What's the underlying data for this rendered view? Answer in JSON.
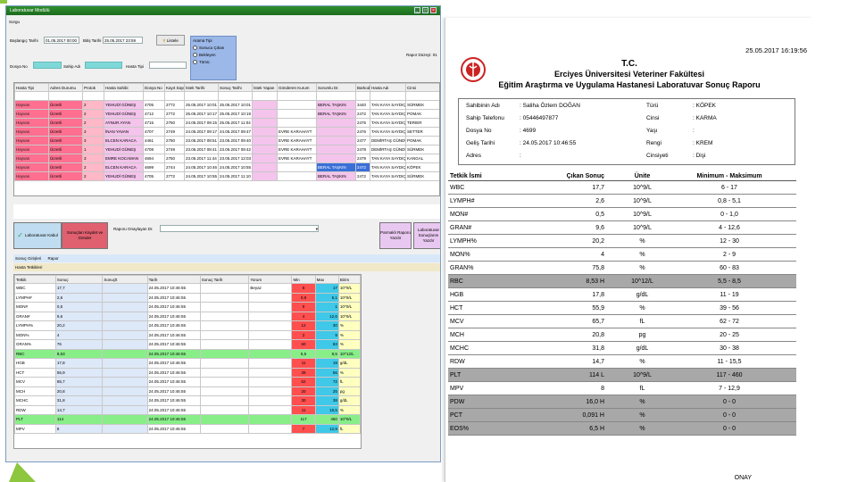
{
  "window": {
    "title": "Laboratuvar Modülü"
  },
  "form": {
    "section": "Sorgu",
    "baslangic_label": "Başlangıç Tarihi",
    "baslangic_value": "01.05.2017 00:00",
    "bitis_label": "Bitiş Tarihi",
    "bitis_value": "25.05.2017 23:59",
    "listele": "Listele",
    "dosya_label": "Dosya No",
    "sahip_label": "Sahip Adı",
    "hasta_label": "Hasta Tipi",
    "filter_title": "Arama Tipi",
    "filter_opts": [
      "Sonucu Çıkan",
      "Bekleyen",
      "Tümü"
    ],
    "rapor_label": "Rapor Düzeyi: 01"
  },
  "grid1": {
    "headers": [
      "Hasta Tipi",
      "Adres Durumu",
      "Protok",
      "Hasta Sahibi",
      "Dosya No",
      "Kayıt Sayısı",
      "İstek Tarihi",
      "Sonuç Tarihi",
      "İstek Yapan",
      "Gönderen Kurum",
      "Sorumlu Dr.",
      "Barkod",
      "Hasta Adı",
      "Cinsi"
    ],
    "rows": [
      [
        "Hayvan",
        "Ücretli",
        "2",
        "YEHUDİ GÜNEŞ",
        "4705",
        "2772",
        "25.05.2017 10:01",
        "25.05.2017 10:01",
        "",
        "",
        "BERAL TAŞKIN",
        "3440",
        "TAN KAYA SAYDIÇ",
        "SÜRMEK"
      ],
      [
        "Hayvan",
        "Ücretli",
        "2",
        "YEHUDİ GÜNEŞ",
        "4712",
        "2772",
        "25.05.2017 10:17",
        "25.05.2017 10:19",
        "",
        "",
        "BERAL TAŞKIN",
        "2472",
        "TAN KAYA SAYDIÇ",
        "POMAK"
      ],
      [
        "Hayvan",
        "Ücretli",
        "2",
        "AYNUR AYAN",
        "4715",
        "2750",
        "24.05.2017 09:15",
        "25.05.2017 11:04",
        "",
        "",
        "",
        "2475",
        "TAN KAYA SAYDIÇ",
        "TERIER"
      ],
      [
        "Hayvan",
        "Ücretli",
        "3",
        "İNAN YAVAN",
        "4707",
        "2749",
        "24.05.2017 09:17",
        "24.05.2017 09:47",
        "",
        "EVRE KARAHAYT",
        "",
        "2476",
        "TAN KAYA SAYDIÇ",
        "SETTER"
      ],
      [
        "Hayvan",
        "Ücretli",
        "3",
        "ELCEN KARACA",
        "4461",
        "2750",
        "23.05.2017 08:51",
        "23.05.2017 09:40",
        "",
        "EVRE KARAHAYT",
        "",
        "2477",
        "DEMİRTAŞ GÜNDÜZ",
        "POMAK"
      ],
      [
        "Hayvan",
        "Ücretli",
        "1",
        "YEHUDİ GÜNEŞ",
        "4708",
        "2749",
        "23.05.2017 08:41",
        "23.05.2017 09:42",
        "",
        "EVRE KARAHAYT",
        "",
        "2478",
        "DEMİRTAŞ GÜNDÜZ",
        "SÜRMEK"
      ],
      [
        "Hayvan",
        "Ücretli",
        "3",
        "EMRE KOCAMAN",
        "4694",
        "2750",
        "23.05.2017 11:44",
        "23.05.2017 12:03",
        "",
        "EVRE KARAHAYT",
        "",
        "2479",
        "TAN KAYA SAYDIÇ",
        "KANGAL"
      ],
      [
        "Hayvan",
        "Ücretli",
        "2",
        "ELCEN KARACA",
        "4699",
        "2744",
        "24.05.2017 10:46",
        "24.05.2017 10:55",
        "",
        "",
        "BERAL TAŞKIN",
        "2472",
        "TAN KAYA SAYDIÇ",
        "KÖPEK"
      ],
      [
        "Hayvan",
        "Ücretli",
        "2",
        "YEHUDİ GÜNEŞ",
        "4705",
        "2772",
        "24.05.2017 10:55",
        "24.05.2017 11:10",
        "",
        "",
        "BERAL TAŞKIN",
        "2472",
        "TAN KAYA SAYDIÇ",
        "SÜRMEK"
      ]
    ],
    "selected_row": 7
  },
  "buttons": {
    "lab_kabul": "Laboratuvar Kabul",
    "sonuc_kayit": "Sonuçları Kaydet ve Gönder",
    "rapor_onay_label": "Raporu Onaylayan Dr.",
    "yazdir": "Parmaklı Raporu Yazdır",
    "sonuclari_yazdir": "Laboratuvar Sonuçlarını Yazdır"
  },
  "tabs": [
    "Sonuç Girişleri",
    "Rapor"
  ],
  "subtab": "Hasta Tetkikleri",
  "grid2": {
    "headers": [
      "Tetkik",
      "Sonuç",
      "Sonuçlt",
      "Tarih",
      "Sonuç Tarih",
      "Yorum",
      "Min",
      "Max",
      "Birim"
    ],
    "rows": [
      [
        "WBC",
        "17,7",
        "24.05.2017 10:46:55",
        "",
        "Beyaz",
        "6",
        "17",
        "10^9/L"
      ],
      [
        "LYMPH#",
        "2,6",
        "24.05.2017 10:46:55",
        "",
        "",
        "0,8",
        "5,1",
        "10^9/L"
      ],
      [
        "MON#",
        "0,5",
        "24.05.2017 10:46:55",
        "",
        "",
        "0",
        "1",
        "10^9/L"
      ],
      [
        "GRAN#",
        "9,6",
        "24.05.2017 10:46:55",
        "",
        "",
        "4",
        "12,6",
        "10^9/L"
      ],
      [
        "LYMPH%",
        "20,2",
        "24.05.2017 10:46:55",
        "",
        "",
        "12",
        "30",
        "%"
      ],
      [
        "MON%",
        "4",
        "24.05.2017 10:46:55",
        "",
        "",
        "2",
        "9",
        "%"
      ],
      [
        "GRAN%",
        "76",
        "24.05.2017 10:46:55",
        "",
        "",
        "60",
        "83",
        "%"
      ],
      [
        "RBC",
        "8,53",
        "24.05.2017 10:46:55",
        "",
        "",
        "5,5",
        "8,5",
        "10^12/L"
      ],
      [
        "HGB",
        "17,8",
        "24.05.2017 10:46:55",
        "",
        "",
        "11",
        "19",
        "g/dL"
      ],
      [
        "HCT",
        "55,9",
        "24.05.2017 10:46:55",
        "",
        "",
        "39",
        "56",
        "%"
      ],
      [
        "MCV",
        "65,7",
        "24.05.2017 10:46:55",
        "",
        "",
        "62",
        "72",
        "fL"
      ],
      [
        "MCH",
        "20,8",
        "24.05.2017 10:46:55",
        "",
        "",
        "20",
        "25",
        "pg"
      ],
      [
        "MCHC",
        "31,8",
        "24.05.2017 10:46:55",
        "",
        "",
        "30",
        "38",
        "g/dL"
      ],
      [
        "RDW",
        "14,7",
        "24.05.2017 10:46:55",
        "",
        "",
        "11",
        "15,5",
        "%"
      ],
      [
        "PLT",
        "114",
        "24.05.2017 10:46:55",
        "",
        "",
        "117",
        "460",
        "10^9/L"
      ],
      [
        "MPV",
        "8",
        "24.05.2017 10:46:55",
        "",
        "",
        "7",
        "12,9",
        "fL"
      ]
    ],
    "green_rows": [
      7,
      14
    ]
  },
  "report": {
    "date": "25.05.2017 16:19:56",
    "t1": "T.C.",
    "t2": "Erciyes Üniversitesi Veteriner Fakültesi",
    "t3": "Eğitim Araştırma ve Uygulama Hastanesi Laboratuvar Sonuç Raporu",
    "info": [
      [
        "Sahibinin Adı",
        ": Saliha Özlem DOĞAN",
        "Türü",
        ": KÖPEK"
      ],
      [
        "Sahip Telefonu",
        ": 05446497877",
        "Cinsi",
        ": KARMA"
      ],
      [
        "Dosya No",
        ": 4699",
        "Yaşı",
        ":"
      ],
      [
        "Geliş Tarihi",
        ": 24.05.2017 10:46:55",
        "Rengi",
        ": KREM"
      ],
      [
        "Adres",
        ":",
        "Cinsiyeti",
        ": Dişi"
      ]
    ],
    "headers": [
      "Tetkik İsmi",
      "Çıkan Sonuç",
      "Ünite",
      "Minimum  -  Maksimum"
    ],
    "rows": [
      [
        "WBC",
        "17,7",
        "10^9/L",
        "6 - 17"
      ],
      [
        "LYMPH#",
        "2,6",
        "10^9/L",
        "0,8 - 5,1"
      ],
      [
        "MON#",
        "0,5",
        "10^9/L",
        "0 - 1,0"
      ],
      [
        "GRAN#",
        "9,6",
        "10^9/L",
        "4 - 12,6"
      ],
      [
        "LYMPH%",
        "20,2",
        "%",
        "12 - 30"
      ],
      [
        "MON%",
        "4",
        "%",
        "2 - 9"
      ],
      [
        "GRAN%",
        "75,8",
        "%",
        "60 - 83"
      ],
      [
        "RBC",
        "8,53 H",
        "10^12/L",
        "5,5 - 8,5"
      ],
      [
        "HGB",
        "17,8",
        "g/dL",
        "11 - 19"
      ],
      [
        "HCT",
        "55,9",
        "%",
        "39 - 56"
      ],
      [
        "MCV",
        "65,7",
        "fL",
        "62 - 72"
      ],
      [
        "MCH",
        "20,8",
        "pg",
        "20 - 25"
      ],
      [
        "MCHC",
        "31,8",
        "g/dL",
        "30 - 38"
      ],
      [
        "RDW",
        "14,7",
        "%",
        "11 - 15,5"
      ],
      [
        "PLT",
        "114 L",
        "10^9/L",
        "117 - 460"
      ],
      [
        "MPV",
        "8",
        "fL",
        "7 - 12,9"
      ],
      [
        "PDW",
        "16,0 H",
        "%",
        "0 - 0"
      ],
      [
        "PCT",
        "0,091 H",
        "%",
        "0 - 0"
      ],
      [
        "EOS%",
        "6,5 H",
        "%",
        "0 - 0"
      ]
    ],
    "gray_rows": [
      7,
      14,
      16,
      17,
      18
    ],
    "footer": "ONAY"
  }
}
